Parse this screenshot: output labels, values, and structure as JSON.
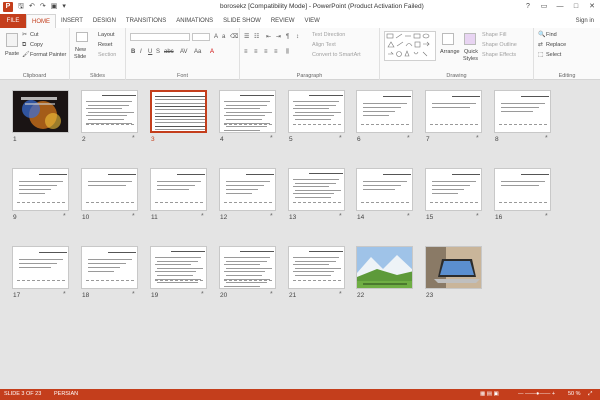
{
  "window": {
    "title": "borosekz [Compatibility Mode] - PowerPoint (Product Activation Failed)",
    "qat_icons": [
      "save-icon",
      "undo-icon",
      "redo-icon",
      "start-presentation-icon"
    ],
    "controls": [
      "?",
      "▭",
      "—",
      "□",
      "✕"
    ]
  },
  "tabs": {
    "file": "FILE",
    "items": [
      "HOME",
      "INSERT",
      "DESIGN",
      "TRANSITIONS",
      "ANIMATIONS",
      "SLIDE SHOW",
      "REVIEW",
      "VIEW"
    ],
    "signin": "Sign in"
  },
  "ribbon": {
    "clipboard": {
      "label": "Clipboard",
      "paste": "Paste",
      "cut": "Cut",
      "copy": "Copy",
      "format_painter": "Format Painter"
    },
    "slides": {
      "label": "Slides",
      "new_slide": "New",
      "new_slide_2": "Slide",
      "layout": "Layout",
      "reset": "Reset",
      "section": "Section"
    },
    "font": {
      "label": "Font"
    },
    "paragraph": {
      "label": "Paragraph",
      "text_direction": "Text Direction",
      "align_text": "Align Text",
      "convert_smartart": "Convert to SmartArt"
    },
    "drawing": {
      "label": "Drawing",
      "arrange": "Arrange",
      "quick_styles": "Quick",
      "quick_styles_2": "Styles",
      "shape_fill": "Shape Fill",
      "shape_outline": "Shape Outline",
      "shape_effects": "Shape Effects"
    },
    "editing": {
      "label": "Editing",
      "find": "Find",
      "replace": "Replace",
      "select": "Select"
    }
  },
  "slides": [
    {
      "num": "1",
      "kind": "image-dark",
      "star": false
    },
    {
      "num": "2",
      "kind": "text",
      "star": true
    },
    {
      "num": "3",
      "kind": "text-dense",
      "star": false,
      "selected": true
    },
    {
      "num": "4",
      "kind": "text",
      "star": true
    },
    {
      "num": "5",
      "kind": "text",
      "star": true
    },
    {
      "num": "6",
      "kind": "text-sparse",
      "star": true
    },
    {
      "num": "7",
      "kind": "text-sparse",
      "star": true
    },
    {
      "num": "8",
      "kind": "text-sparse",
      "star": true
    },
    {
      "num": "9",
      "kind": "text-sparse",
      "star": true
    },
    {
      "num": "10",
      "kind": "text-sparse",
      "star": true
    },
    {
      "num": "11",
      "kind": "text-sparse",
      "star": true
    },
    {
      "num": "12",
      "kind": "text-sparse",
      "star": true
    },
    {
      "num": "13",
      "kind": "text",
      "star": true
    },
    {
      "num": "14",
      "kind": "text-sparse",
      "star": true
    },
    {
      "num": "15",
      "kind": "text-sparse",
      "star": true
    },
    {
      "num": "16",
      "kind": "text-sparse",
      "star": true
    },
    {
      "num": "17",
      "kind": "text-sparse",
      "star": true
    },
    {
      "num": "18",
      "kind": "text-sparse",
      "star": true
    },
    {
      "num": "19",
      "kind": "text",
      "star": true
    },
    {
      "num": "20",
      "kind": "text",
      "star": true
    },
    {
      "num": "21",
      "kind": "text",
      "star": true
    },
    {
      "num": "22",
      "kind": "image-landscape",
      "star": false
    },
    {
      "num": "23",
      "kind": "image-laptop",
      "star": false
    }
  ],
  "colors": {
    "accent": "#c43e1c",
    "selected_border": "#c43e1c",
    "statusbar": "#c43e1c"
  },
  "status": {
    "slide": "SLIDE 3 OF 23",
    "language": "PERSIAN",
    "zoom": "50 %"
  }
}
